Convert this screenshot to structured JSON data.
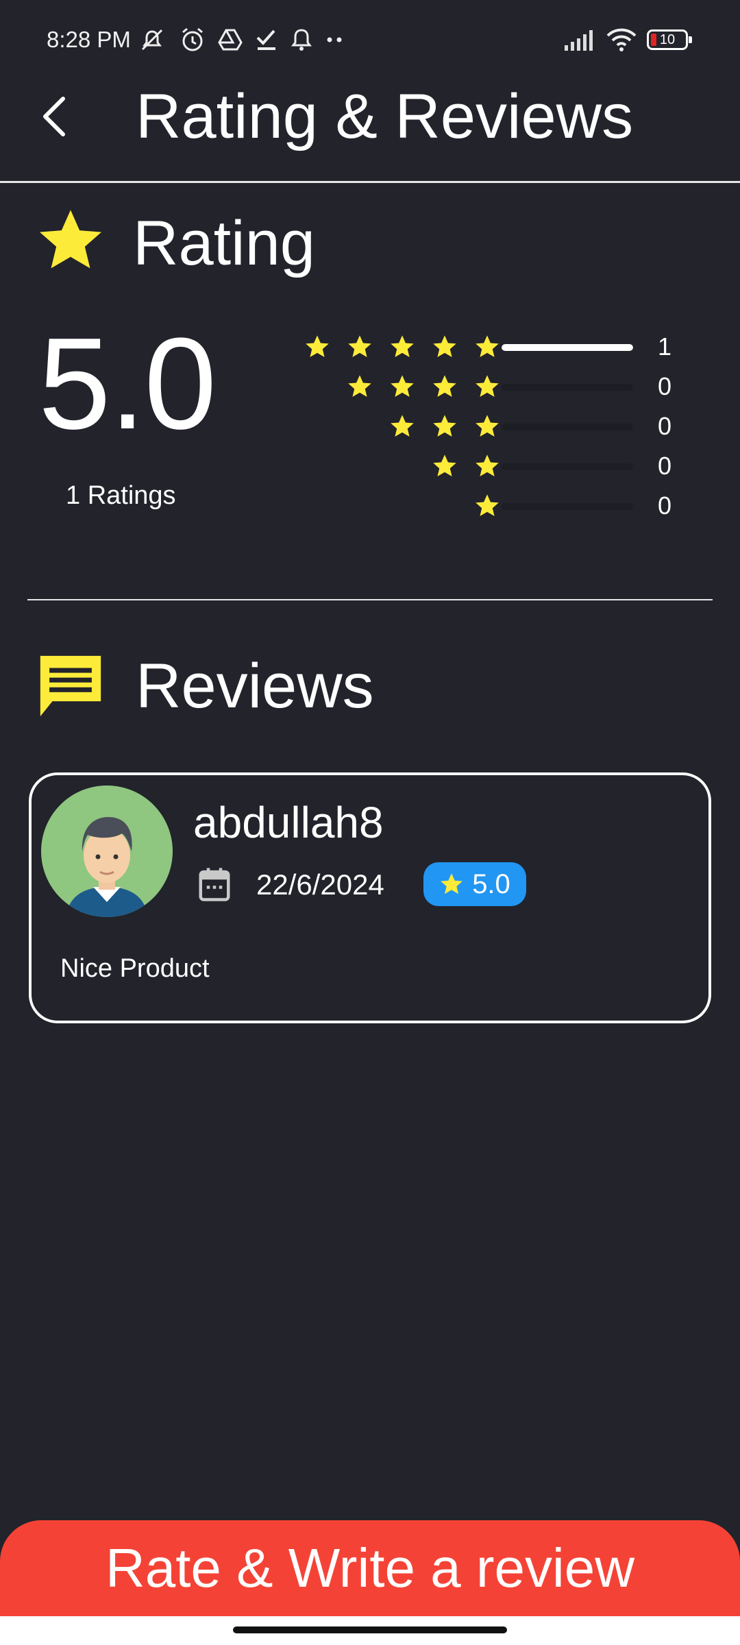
{
  "status_bar": {
    "time": "8:28 PM",
    "battery": "10",
    "icons": [
      "mute-icon",
      "alarm-icon",
      "drive-icon",
      "check-icon",
      "bell-icon",
      "more-dots-icon",
      "signal-icon",
      "wifi-icon",
      "battery-icon"
    ]
  },
  "header": {
    "title": "Rating & Reviews"
  },
  "rating": {
    "section_title": "Rating",
    "average": "5.0",
    "count_label": "1 Ratings",
    "distribution": [
      {
        "stars": 5,
        "count": "1",
        "fraction": 1.0
      },
      {
        "stars": 4,
        "count": "0",
        "fraction": 0
      },
      {
        "stars": 3,
        "count": "0",
        "fraction": 0
      },
      {
        "stars": 2,
        "count": "0",
        "fraction": 0
      },
      {
        "stars": 1,
        "count": "0",
        "fraction": 0
      }
    ]
  },
  "reviews": {
    "section_title": "Reviews",
    "items": [
      {
        "username": "abdullah8",
        "date": "22/6/2024",
        "score": "5.0",
        "text": "Nice Product"
      }
    ]
  },
  "cta": {
    "label": "Rate & Write a review"
  },
  "colors": {
    "background": "#22232b",
    "star": "#fdeb3a",
    "badge": "#2196f3",
    "cta": "#f44336",
    "avatar_bg": "#8fc680"
  }
}
